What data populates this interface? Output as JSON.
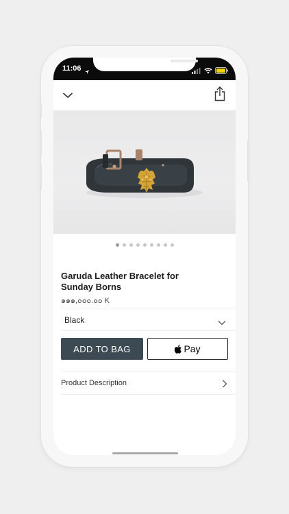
{
  "status_bar": {
    "time": "11:06"
  },
  "product": {
    "title": "Garuda Leather Bracelet for Sunday Borns",
    "price": "๑๑๑,๐๐๐.๐๐ K",
    "image_pages": 9,
    "active_image_index": 0
  },
  "variant": {
    "selected": "Black"
  },
  "actions": {
    "add_to_bag_label": "ADD TO BAG",
    "apple_pay_label": "Pay"
  },
  "description_row": {
    "label": "Product Description"
  },
  "colors": {
    "add_button": "#3d4a54",
    "strap": "#2f3539",
    "charm": "#d4a437",
    "buckle": "#a8826b"
  },
  "icons": [
    "location-arrow-icon",
    "signal-icon",
    "wifi-icon",
    "battery-icon",
    "chevron-down-icon",
    "share-icon",
    "apple-logo-icon",
    "chevron-right-icon"
  ]
}
